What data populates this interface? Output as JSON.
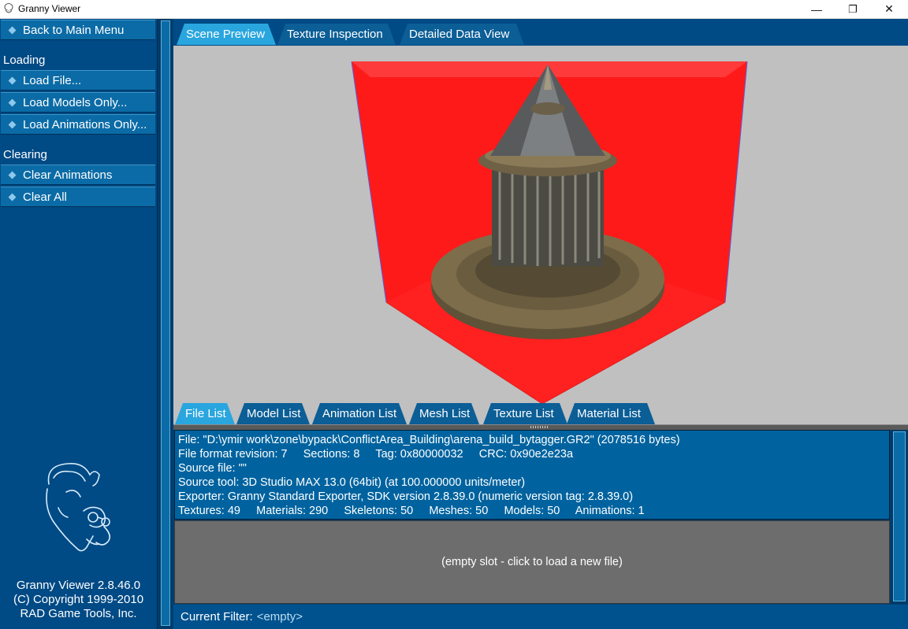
{
  "window": {
    "title": "Granny Viewer",
    "minimize": "—",
    "restore": "❐",
    "close": "✕"
  },
  "sidebar": {
    "back_button": "Back to Main Menu",
    "sections": [
      {
        "heading": "Loading",
        "items": [
          "Load File...",
          "Load Models Only...",
          "Load Animations Only..."
        ]
      },
      {
        "heading": "Clearing",
        "items": [
          "Clear Animations",
          "Clear All"
        ]
      }
    ],
    "about": [
      "Granny Viewer 2.8.46.0",
      "(C) Copyright 1999-2010",
      "RAD Game Tools, Inc."
    ]
  },
  "top_tabs": [
    {
      "label": "Scene Preview",
      "active": true
    },
    {
      "label": "Texture Inspection",
      "active": false
    },
    {
      "label": "Detailed Data View",
      "active": false
    }
  ],
  "bottom_tabs": [
    {
      "label": "File List",
      "active": true
    },
    {
      "label": "Model List",
      "active": false
    },
    {
      "label": "Animation List",
      "active": false
    },
    {
      "label": "Mesh List",
      "active": false
    },
    {
      "label": "Texture List",
      "active": false
    },
    {
      "label": "Material List",
      "active": false
    }
  ],
  "file_info": {
    "lines": [
      "File: \"D:\\ymir work\\zone\\bypack\\ConflictArea_Building\\arena_build_bytagger.GR2\" (2078516 bytes)",
      "File format revision: 7     Sections: 8     Tag: 0x80000032     CRC: 0x90e2e23a",
      "Source file: \"\"",
      "Source tool: 3D Studio MAX 13.0 (64bit) (at 100.000000 units/meter)",
      "Exporter: Granny Standard Exporter, SDK version 2.8.39.0 (numeric version tag: 2.8.39.0)",
      "Textures: 49     Materials: 290     Skeletons: 50     Meshes: 50     Models: 50     Animations: 1"
    ]
  },
  "empty_slot": "(empty slot - click to load a new file)",
  "filter": {
    "label": "Current Filter:",
    "value": "<empty>"
  },
  "colors": {
    "panel_blue": "#004a85",
    "button_blue": "#0b6ba6",
    "active_tab": "#2aa6df",
    "bounding_box": "#ff1010",
    "viewport_bg": "#c0c0c0"
  }
}
